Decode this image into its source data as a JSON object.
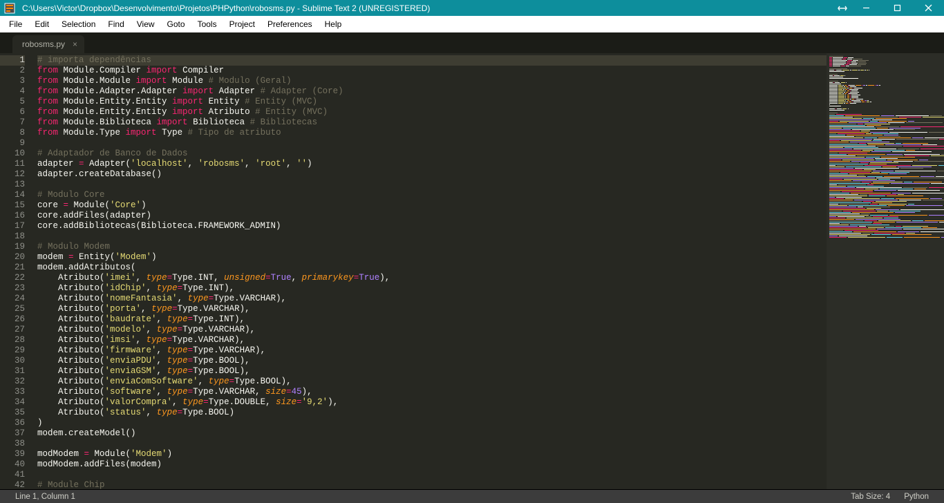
{
  "title": "C:\\Users\\Victor\\Dropbox\\Desenvolvimento\\Projetos\\PHPython\\robosms.py - Sublime Text 2 (UNREGISTERED)",
  "menu": [
    "File",
    "Edit",
    "Selection",
    "Find",
    "View",
    "Goto",
    "Tools",
    "Project",
    "Preferences",
    "Help"
  ],
  "tab": {
    "label": "robosms.py"
  },
  "status": {
    "left": "Line 1, Column 1",
    "tabsize": "Tab Size: 4",
    "syntax": "Python"
  },
  "code_lines": [
    [
      [
        "c",
        "# importa dependências"
      ]
    ],
    [
      [
        "kw",
        "from"
      ],
      [
        "nm",
        " Module.Compiler "
      ],
      [
        "kw",
        "import"
      ],
      [
        "nm",
        " Compiler"
      ]
    ],
    [
      [
        "kw",
        "from"
      ],
      [
        "nm",
        " Module.Module "
      ],
      [
        "kw",
        "import"
      ],
      [
        "nm",
        " Module "
      ],
      [
        "c",
        "# Modulo (Geral)"
      ]
    ],
    [
      [
        "kw",
        "from"
      ],
      [
        "nm",
        " Module.Adapter.Adapter "
      ],
      [
        "kw",
        "import"
      ],
      [
        "nm",
        " Adapter "
      ],
      [
        "c",
        "# Adapter (Core)"
      ]
    ],
    [
      [
        "kw",
        "from"
      ],
      [
        "nm",
        " Module.Entity.Entity "
      ],
      [
        "kw",
        "import"
      ],
      [
        "nm",
        " Entity "
      ],
      [
        "c",
        "# Entity (MVC)"
      ]
    ],
    [
      [
        "kw",
        "from"
      ],
      [
        "nm",
        " Module.Entity.Entity "
      ],
      [
        "kw",
        "import"
      ],
      [
        "nm",
        " Atributo "
      ],
      [
        "c",
        "# Entity (MVC)"
      ]
    ],
    [
      [
        "kw",
        "from"
      ],
      [
        "nm",
        " Module.Biblioteca "
      ],
      [
        "kw",
        "import"
      ],
      [
        "nm",
        " Biblioteca "
      ],
      [
        "c",
        "# Bibliotecas"
      ]
    ],
    [
      [
        "kw",
        "from"
      ],
      [
        "nm",
        " Module.Type "
      ],
      [
        "kw",
        "import"
      ],
      [
        "nm",
        " Type "
      ],
      [
        "c",
        "# Tipo de atributo"
      ]
    ],
    [
      [
        "nm",
        ""
      ]
    ],
    [
      [
        "c",
        "# Adaptador de Banco de Dados"
      ]
    ],
    [
      [
        "nm",
        "adapter "
      ],
      [
        "op",
        "="
      ],
      [
        "nm",
        " Adapter("
      ],
      [
        "str",
        "'localhost'"
      ],
      [
        "nm",
        ", "
      ],
      [
        "str",
        "'robosms'"
      ],
      [
        "nm",
        ", "
      ],
      [
        "str",
        "'root'"
      ],
      [
        "nm",
        ", "
      ],
      [
        "str",
        "''"
      ],
      [
        "nm",
        ")"
      ]
    ],
    [
      [
        "nm",
        "adapter.createDatabase()"
      ]
    ],
    [
      [
        "nm",
        ""
      ]
    ],
    [
      [
        "c",
        "# Modulo Core"
      ]
    ],
    [
      [
        "nm",
        "core "
      ],
      [
        "op",
        "="
      ],
      [
        "nm",
        " Module("
      ],
      [
        "str",
        "'Core'"
      ],
      [
        "nm",
        ")"
      ]
    ],
    [
      [
        "nm",
        "core.addFiles(adapter)"
      ]
    ],
    [
      [
        "nm",
        "core.addBibliotecas(Biblioteca.FRAMEWORK_ADMIN)"
      ]
    ],
    [
      [
        "nm",
        ""
      ]
    ],
    [
      [
        "c",
        "# Modulo Modem"
      ]
    ],
    [
      [
        "nm",
        "modem "
      ],
      [
        "op",
        "="
      ],
      [
        "nm",
        " Entity("
      ],
      [
        "str",
        "'Modem'"
      ],
      [
        "nm",
        ")"
      ]
    ],
    [
      [
        "nm",
        "modem.addAtributos("
      ]
    ],
    [
      [
        "nm",
        "    Atributo("
      ],
      [
        "str",
        "'imei'"
      ],
      [
        "nm",
        ", "
      ],
      [
        "arg",
        "type"
      ],
      [
        "op",
        "="
      ],
      [
        "nm",
        "Type.INT, "
      ],
      [
        "arg",
        "unsigned"
      ],
      [
        "op",
        "="
      ],
      [
        "num",
        "True"
      ],
      [
        "nm",
        ", "
      ],
      [
        "arg",
        "primarykey"
      ],
      [
        "op",
        "="
      ],
      [
        "num",
        "True"
      ],
      [
        "nm",
        "),"
      ]
    ],
    [
      [
        "nm",
        "    Atributo("
      ],
      [
        "str",
        "'idChip'"
      ],
      [
        "nm",
        ", "
      ],
      [
        "arg",
        "type"
      ],
      [
        "op",
        "="
      ],
      [
        "nm",
        "Type.INT),"
      ]
    ],
    [
      [
        "nm",
        "    Atributo("
      ],
      [
        "str",
        "'nomeFantasia'"
      ],
      [
        "nm",
        ", "
      ],
      [
        "arg",
        "type"
      ],
      [
        "op",
        "="
      ],
      [
        "nm",
        "Type.VARCHAR),"
      ]
    ],
    [
      [
        "nm",
        "    Atributo("
      ],
      [
        "str",
        "'porta'"
      ],
      [
        "nm",
        ", "
      ],
      [
        "arg",
        "type"
      ],
      [
        "op",
        "="
      ],
      [
        "nm",
        "Type.VARCHAR),"
      ]
    ],
    [
      [
        "nm",
        "    Atributo("
      ],
      [
        "str",
        "'baudrate'"
      ],
      [
        "nm",
        ", "
      ],
      [
        "arg",
        "type"
      ],
      [
        "op",
        "="
      ],
      [
        "nm",
        "Type.INT),"
      ]
    ],
    [
      [
        "nm",
        "    Atributo("
      ],
      [
        "str",
        "'modelo'"
      ],
      [
        "nm",
        ", "
      ],
      [
        "arg",
        "type"
      ],
      [
        "op",
        "="
      ],
      [
        "nm",
        "Type.VARCHAR),"
      ]
    ],
    [
      [
        "nm",
        "    Atributo("
      ],
      [
        "str",
        "'imsi'"
      ],
      [
        "nm",
        ", "
      ],
      [
        "arg",
        "type"
      ],
      [
        "op",
        "="
      ],
      [
        "nm",
        "Type.VARCHAR),"
      ]
    ],
    [
      [
        "nm",
        "    Atributo("
      ],
      [
        "str",
        "'firmware'"
      ],
      [
        "nm",
        ", "
      ],
      [
        "arg",
        "type"
      ],
      [
        "op",
        "="
      ],
      [
        "nm",
        "Type.VARCHAR),"
      ]
    ],
    [
      [
        "nm",
        "    Atributo("
      ],
      [
        "str",
        "'enviaPDU'"
      ],
      [
        "nm",
        ", "
      ],
      [
        "arg",
        "type"
      ],
      [
        "op",
        "="
      ],
      [
        "nm",
        "Type.BOOL),"
      ]
    ],
    [
      [
        "nm",
        "    Atributo("
      ],
      [
        "str",
        "'enviaGSM'"
      ],
      [
        "nm",
        ", "
      ],
      [
        "arg",
        "type"
      ],
      [
        "op",
        "="
      ],
      [
        "nm",
        "Type.BOOL),"
      ]
    ],
    [
      [
        "nm",
        "    Atributo("
      ],
      [
        "str",
        "'enviaComSoftware'"
      ],
      [
        "nm",
        ", "
      ],
      [
        "arg",
        "type"
      ],
      [
        "op",
        "="
      ],
      [
        "nm",
        "Type.BOOL),"
      ]
    ],
    [
      [
        "nm",
        "    Atributo("
      ],
      [
        "str",
        "'software'"
      ],
      [
        "nm",
        ", "
      ],
      [
        "arg",
        "type"
      ],
      [
        "op",
        "="
      ],
      [
        "nm",
        "Type.VARCHAR, "
      ],
      [
        "arg",
        "size"
      ],
      [
        "op",
        "="
      ],
      [
        "num",
        "45"
      ],
      [
        "nm",
        "),"
      ]
    ],
    [
      [
        "nm",
        "    Atributo("
      ],
      [
        "str",
        "'valorCompra'"
      ],
      [
        "nm",
        ", "
      ],
      [
        "arg",
        "type"
      ],
      [
        "op",
        "="
      ],
      [
        "nm",
        "Type.DOUBLE, "
      ],
      [
        "arg",
        "size"
      ],
      [
        "op",
        "="
      ],
      [
        "str",
        "'9,2'"
      ],
      [
        "nm",
        "),"
      ]
    ],
    [
      [
        "nm",
        "    Atributo("
      ],
      [
        "str",
        "'status'"
      ],
      [
        "nm",
        ", "
      ],
      [
        "arg",
        "type"
      ],
      [
        "op",
        "="
      ],
      [
        "nm",
        "Type.BOOL)"
      ]
    ],
    [
      [
        "nm",
        ")"
      ]
    ],
    [
      [
        "nm",
        "modem.createModel()"
      ]
    ],
    [
      [
        "nm",
        ""
      ]
    ],
    [
      [
        "nm",
        "modModem "
      ],
      [
        "op",
        "="
      ],
      [
        "nm",
        " Module("
      ],
      [
        "str",
        "'Modem'"
      ],
      [
        "nm",
        ")"
      ]
    ],
    [
      [
        "nm",
        "modModem.addFiles(modem)"
      ]
    ],
    [
      [
        "nm",
        ""
      ]
    ],
    [
      [
        "c",
        "# Module Chip"
      ]
    ]
  ],
  "minimap_colors": [
    "#75715e",
    "#f92672",
    "#e6db74",
    "#66d9ef",
    "#fd971f",
    "#ae81ff",
    "#f8f8f2"
  ]
}
